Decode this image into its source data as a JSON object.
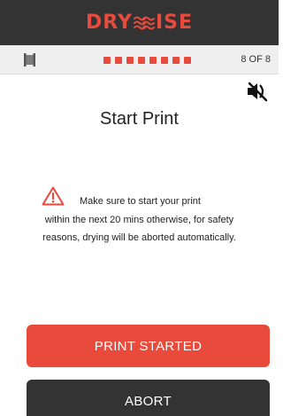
{
  "header": {
    "logo_left": "DRY",
    "logo_right": "ISE",
    "logo_color": "#e84a3c"
  },
  "progress": {
    "total_steps": 8,
    "current_step": 8,
    "step_label": "8 OF 8"
  },
  "icons": {
    "spool": "filament-spool-icon",
    "mute": "speaker-muted-icon",
    "warning": "warning-triangle-icon"
  },
  "main": {
    "title": "Start Print",
    "warning_line1": "Make sure to start your print",
    "warning_line2": "within the next 20 mins otherwise, for safety",
    "warning_line3": "reasons, drying will be aborted automatically."
  },
  "buttons": {
    "primary_label": "PRINT STARTED",
    "secondary_label": "ABORT"
  },
  "colors": {
    "accent": "#e84a3c",
    "dark": "#333333"
  }
}
